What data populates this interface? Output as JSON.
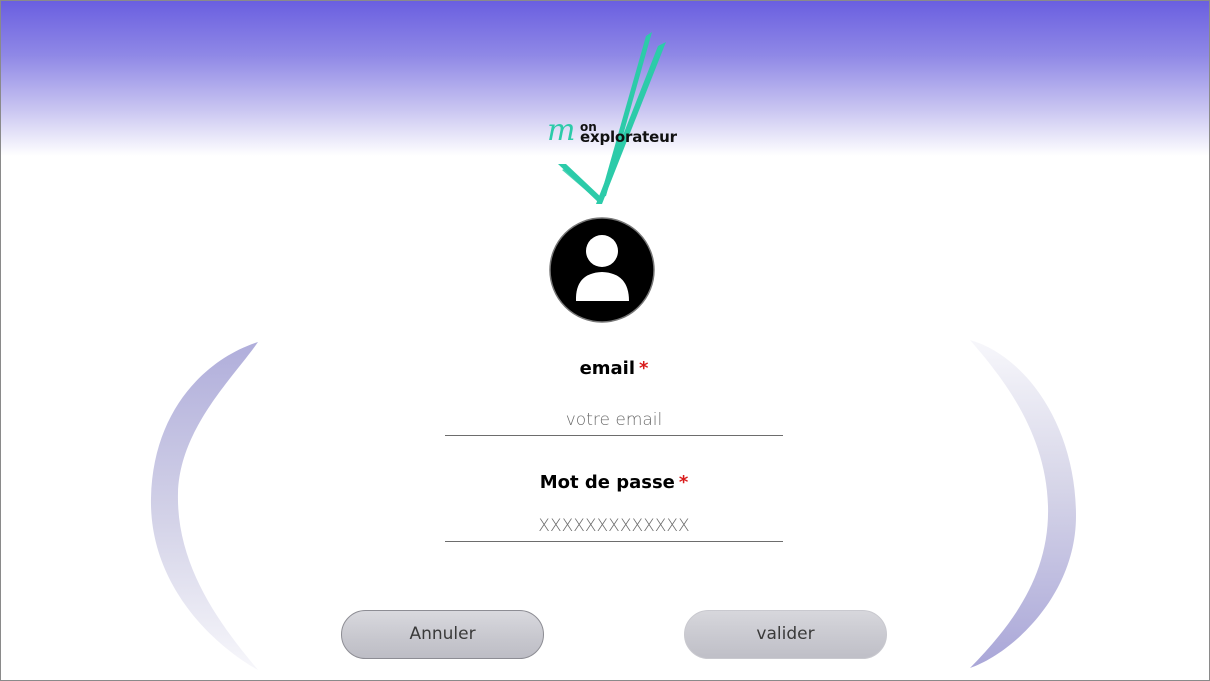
{
  "app": {
    "logo": {
      "m": "m",
      "on": "on",
      "explorateur": "explorateur"
    },
    "colors": {
      "accent": "#2ccba9",
      "header_gradient_top": "#6a5fe0",
      "required_marker": "#d91c1c",
      "button_fill": "#c8c8cf"
    }
  },
  "avatar": {
    "icon": "user-avatar-icon"
  },
  "form": {
    "email": {
      "label": "email",
      "required_marker": "*",
      "placeholder": "votre email",
      "value": ""
    },
    "password": {
      "label": "Mot de passe",
      "required_marker": "*",
      "placeholder": "XXXXXXXXXXXXX",
      "value": ""
    }
  },
  "actions": {
    "cancel_label": "Annuler",
    "submit_label": "valider"
  }
}
